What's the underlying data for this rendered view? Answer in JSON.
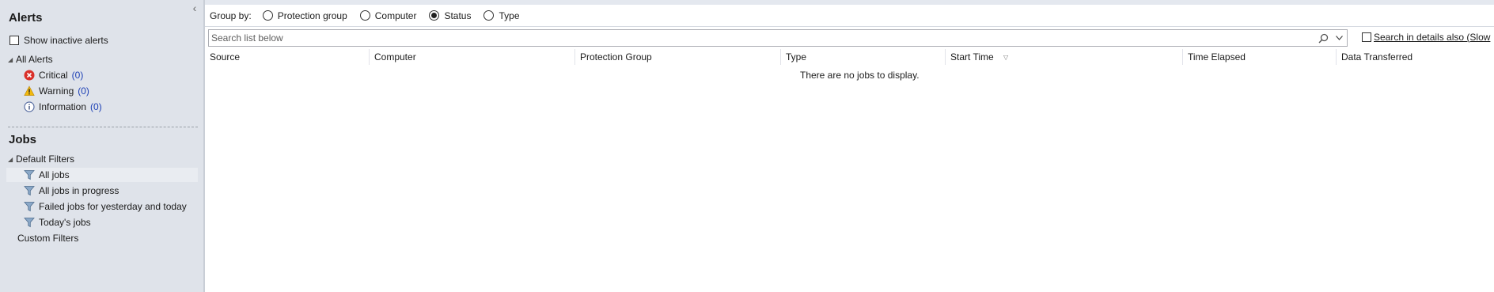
{
  "nav": {
    "collapse_glyph": "‹",
    "alerts": {
      "title": "Alerts",
      "show_inactive_label": "Show inactive alerts",
      "root_label": "All Alerts",
      "items": [
        {
          "label": "Critical",
          "count": "(0)",
          "icon": "error-icon"
        },
        {
          "label": "Warning",
          "count": "(0)",
          "icon": "warning-icon"
        },
        {
          "label": "Information",
          "count": "(0)",
          "icon": "info-icon"
        }
      ]
    },
    "jobs": {
      "title": "Jobs",
      "default_filters_label": "Default Filters",
      "filters": [
        {
          "label": "All jobs",
          "icon": "filter-icon",
          "selected": true
        },
        {
          "label": "All jobs in progress",
          "icon": "filter-icon"
        },
        {
          "label": "Failed jobs for yesterday and today",
          "icon": "filter-icon"
        },
        {
          "label": "Today's jobs",
          "icon": "filter-icon"
        }
      ],
      "custom_filters_label": "Custom Filters"
    }
  },
  "groupby": {
    "label": "Group by:",
    "options": [
      {
        "label": "Protection group",
        "selected": false
      },
      {
        "label": "Computer",
        "selected": false
      },
      {
        "label": "Status",
        "selected": true
      },
      {
        "label": "Type",
        "selected": false
      }
    ]
  },
  "search": {
    "placeholder": "Search list below",
    "details_label": "Search in details also (Slow"
  },
  "table": {
    "columns": [
      "Source",
      "Computer",
      "Protection Group",
      "Type",
      "Start Time",
      "Time Elapsed",
      "Data Transferred"
    ],
    "sorted_column": "Start Time",
    "empty_message": "There are no jobs to display."
  },
  "colors": {
    "nav_bg": "#dfe3ea",
    "count_link": "#1c3fb5",
    "critical": "#d9302a",
    "warning": "#f2b90d",
    "info": "#5a6fa3"
  }
}
